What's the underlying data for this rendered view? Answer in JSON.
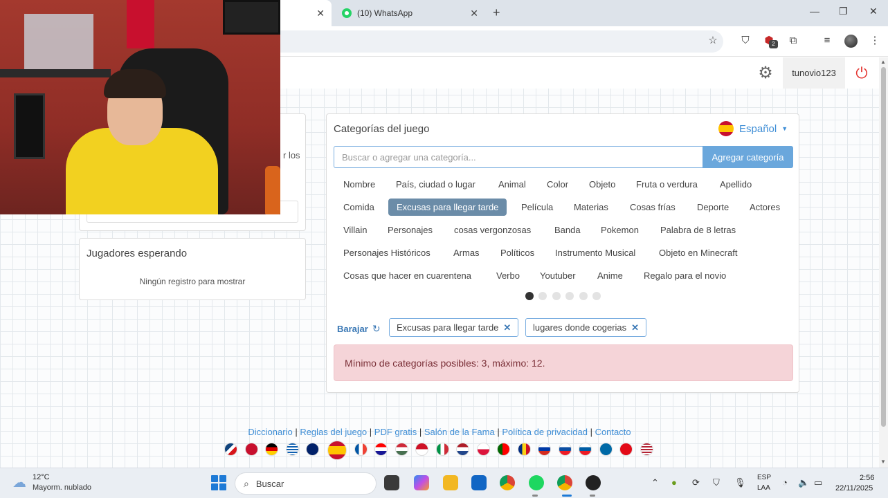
{
  "browser": {
    "active_tab_close": "✕",
    "whatsapp_tab_title": "(10) WhatsApp",
    "whatsapp_tab_close": "✕",
    "new_tab": "+",
    "window": {
      "minimize": "—",
      "restore": "❐",
      "close": "✕"
    },
    "extension_badge": "2",
    "icons": [
      "star-icon",
      "shield-icon",
      "adblock-icon",
      "puzzle-icon",
      "media-icon",
      "profile-avatar"
    ]
  },
  "header": {
    "username": "tunovio123",
    "icons": [
      "gear-icon",
      "power-icon"
    ]
  },
  "left": {
    "partial_text": "r los",
    "waiting_title": "Jugadores esperando",
    "waiting_empty": "Ningún registro para mostrar"
  },
  "categories": {
    "title": "Categorías del juego",
    "language": "Español",
    "search_placeholder": "Buscar o agregar una categoría...",
    "add_button": "Agregar categoría",
    "chips": [
      [
        "Nombre",
        "País, ciudad o lugar",
        "Animal",
        "Color",
        "Objeto",
        "Fruta o verdura",
        "Apellido"
      ],
      [
        "Comida",
        "Excusas para llegar tarde",
        "Película",
        "Materias",
        "Cosas frías",
        "Deporte",
        "Actores"
      ],
      [
        "Villain",
        "Personajes",
        "cosas vergonzosas",
        "Banda",
        "Pokemon",
        "Palabra de 8 letras"
      ],
      [
        "Personajes Históricos",
        "Armas",
        "Políticos",
        "Instrumento Musical",
        "Objeto en Minecraft"
      ],
      [
        "Cosas que hacer en cuarentena",
        "Verbo",
        "Youtuber",
        "Anime",
        "Regalo para el novio"
      ]
    ],
    "selected_chip": "Excusas para llegar tarde",
    "pagination": {
      "pages": 6,
      "current": 1
    },
    "shuffle_label": "Barajar",
    "selected_tags": [
      "Excusas para llegar tarde",
      "lugares donde cogerias"
    ],
    "alert": "Mínimo de categorías posibles: 3, máximo: 12."
  },
  "footer": {
    "links": [
      "Diccionario",
      "Reglas del juego",
      "PDF gratis",
      "Salón de la Fama",
      "Política de privacidad",
      "Contacto"
    ],
    "flags": [
      "czech-flag",
      "denmark-flag",
      "germany-flag",
      "greece-flag",
      "uk-flag",
      "spain-flag",
      "france-flag",
      "croatia-flag",
      "hungary-flag",
      "indonesia-flag",
      "italy-flag",
      "netherlands-flag",
      "poland-flag",
      "portugal-flag",
      "romania-flag",
      "russia-flag",
      "slovakia-flag",
      "slovenia-flag",
      "sweden-flag",
      "turkey-flag",
      "usa-flag"
    ]
  },
  "taskbar": {
    "weather_temp": "12°C",
    "weather_desc": "Mayorm. nublado",
    "search_label": "Buscar",
    "lang_line1": "ESP",
    "lang_line2": "LAA",
    "time": "2:56",
    "date": "22/11/2025"
  }
}
